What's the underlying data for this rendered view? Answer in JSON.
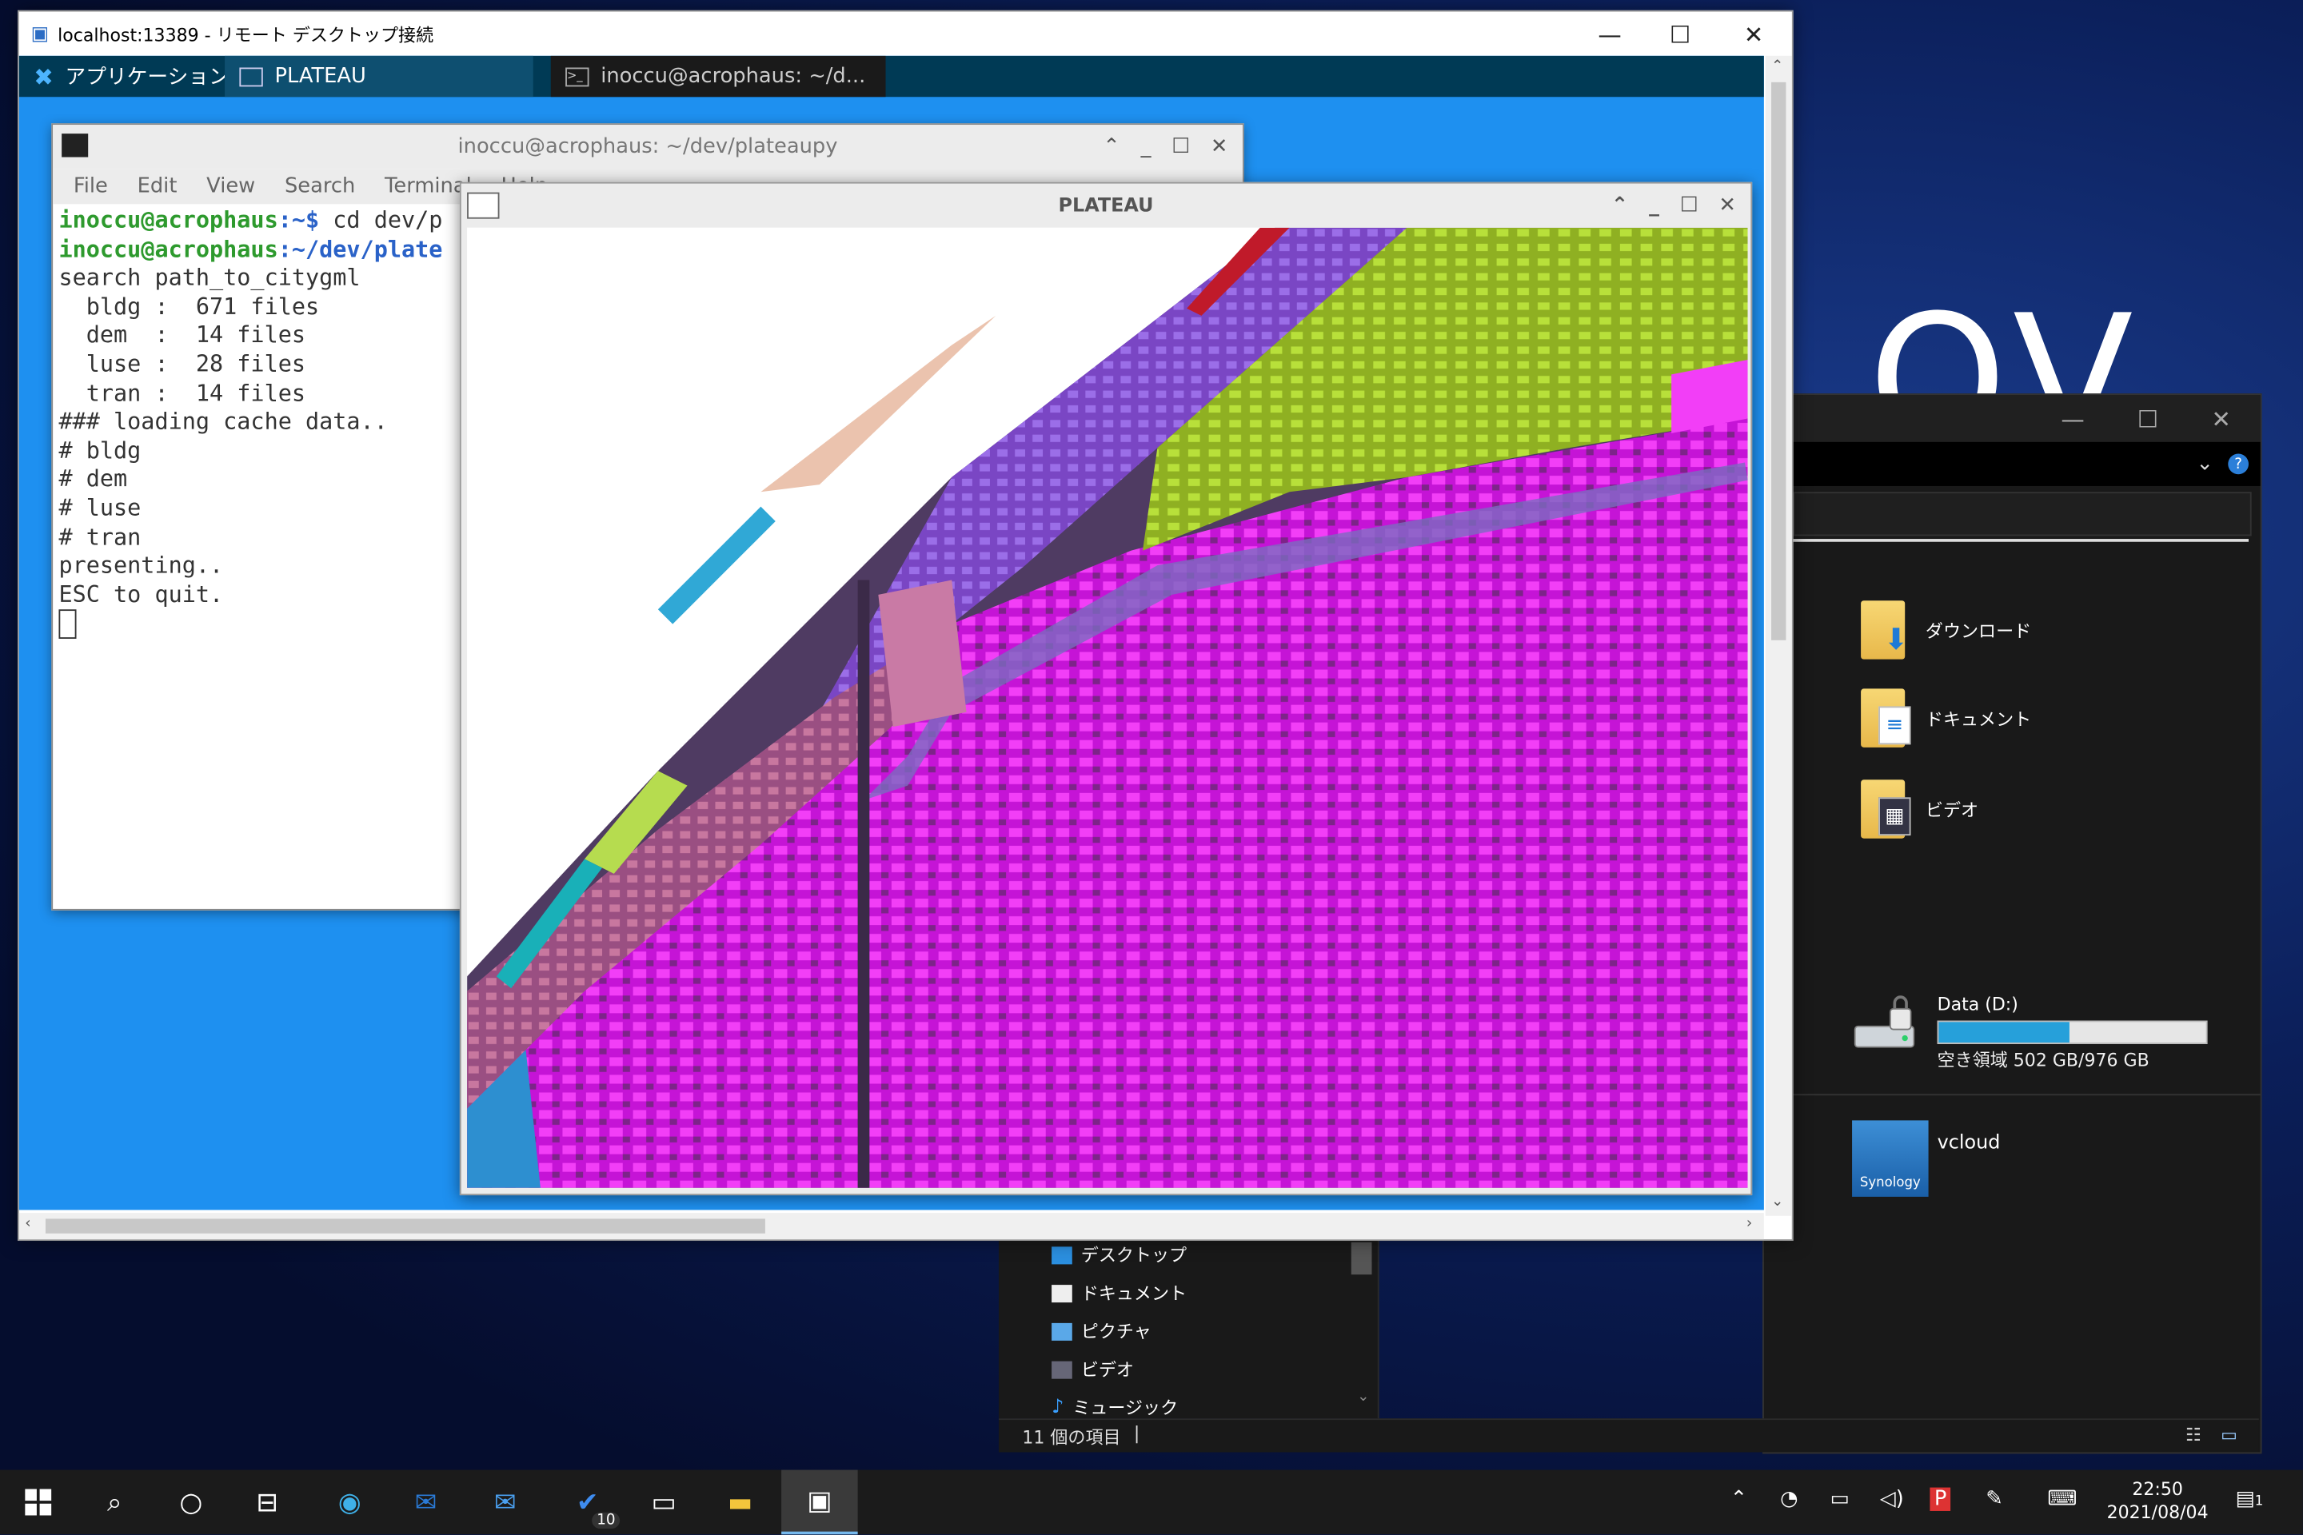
{
  "desktop": {
    "brand_text": "OV"
  },
  "rdp": {
    "title": "localhost:13389 - リモート デスクトップ接続",
    "minimize": "—",
    "maximize": "☐",
    "close": "✕"
  },
  "xfce": {
    "apps_label": "アプリケーション",
    "task1": "PLATEAU",
    "task2": "inoccu@acrophaus: ~/d..."
  },
  "terminal": {
    "title": "inoccu@acrophaus: ~/dev/plateaupy",
    "menu": [
      "File",
      "Edit",
      "View",
      "Search",
      "Terminal",
      "Help"
    ],
    "prompt_user": "inoccu@acrophaus",
    "line1_path": ":~$ ",
    "line1_cmd": "cd dev/p",
    "line2_path": ":~/dev/plate",
    "output": "search path_to_citygml\n  bldg :  671 files\n  dem  :  14 files\n  luse :  28 files\n  tran :  14 files\n### loading cache data..\n# bldg\n# dem\n# luse\n# tran\npresenting..\nESC to quit."
  },
  "plateau": {
    "title": "PLATEAU"
  },
  "explorer": {
    "folders": [
      {
        "label": "ダウンロード",
        "icon": "download-folder-icon"
      },
      {
        "label": "ドキュメント",
        "icon": "documents-folder-icon"
      },
      {
        "label": "ビデオ",
        "icon": "videos-folder-icon"
      }
    ],
    "drive_label": "Data (D:)",
    "drive_used_fraction": 0.49,
    "drive_free_text": "空き領域 502 GB/976 GB",
    "network_label": "vcloud",
    "synology_text": "Synology",
    "nav_items": [
      "デスクトップ",
      "ドキュメント",
      "ピクチャ",
      "ビデオ",
      "ミュージック"
    ],
    "status": "11 個の項目"
  },
  "taskbar": {
    "todo_badge": "10",
    "time": "22:50",
    "date": "2021/08/04",
    "notification_count": "1"
  },
  "colors": {
    "accent": "#26a0da",
    "terminal_user": "#2e9a2e",
    "terminal_path": "#2a62c8",
    "building_magenta": "#d61ce0",
    "building_purple": "#8a4fd8",
    "building_yellowgreen": "#a8d42a"
  }
}
